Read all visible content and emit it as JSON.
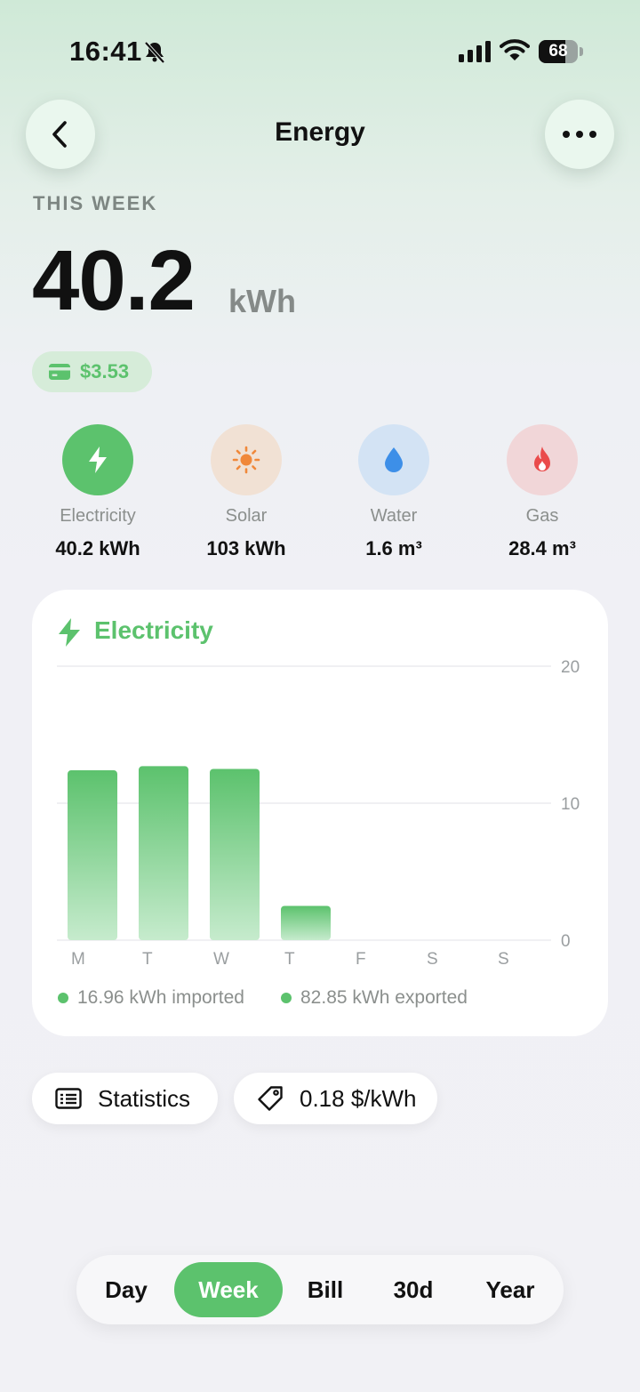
{
  "status_bar": {
    "time": "16:41",
    "battery": "68",
    "battery_level": 0.68
  },
  "header": {
    "title": "Energy",
    "back_icon": "chevron-left-icon",
    "more_icon": "ellipsis-icon"
  },
  "summary": {
    "period_label": "THIS WEEK",
    "total_value": "40.2",
    "total_unit": "kWh",
    "cost": "$3.53"
  },
  "categories": [
    {
      "label": "Electricity",
      "value": "40.2 kWh",
      "icon": "bolt-icon",
      "color": "#5cc26d"
    },
    {
      "label": "Solar",
      "value": "103 kWh",
      "icon": "sun-icon",
      "color": "#f0883a"
    },
    {
      "label": "Water",
      "value": "1.6 m³",
      "icon": "water-drop-icon",
      "color": "#3d8fe8"
    },
    {
      "label": "Gas",
      "value": "28.4 m³",
      "icon": "flame-icon",
      "color": "#ea4b4b"
    }
  ],
  "chart_card": {
    "title": "Electricity",
    "legend": [
      "16.96 kWh imported",
      "82.85 kWh exported"
    ]
  },
  "chart_data": {
    "type": "bar",
    "categories": [
      "M",
      "T",
      "W",
      "T",
      "F",
      "S",
      "S"
    ],
    "values": [
      12.4,
      12.7,
      12.5,
      2.5,
      0,
      0,
      0
    ],
    "ylim": [
      0,
      20
    ],
    "yticks": [
      "20",
      "10",
      "0"
    ],
    "color": "#5cc26d",
    "grid": true
  },
  "actions": {
    "statistics": "Statistics",
    "price": "0.18 $/kWh"
  },
  "range_selector": {
    "options": [
      "Day",
      "Week",
      "Bill",
      "30d",
      "Year"
    ],
    "selected": "Week"
  },
  "colors": {
    "accent": "#5cc26d"
  }
}
